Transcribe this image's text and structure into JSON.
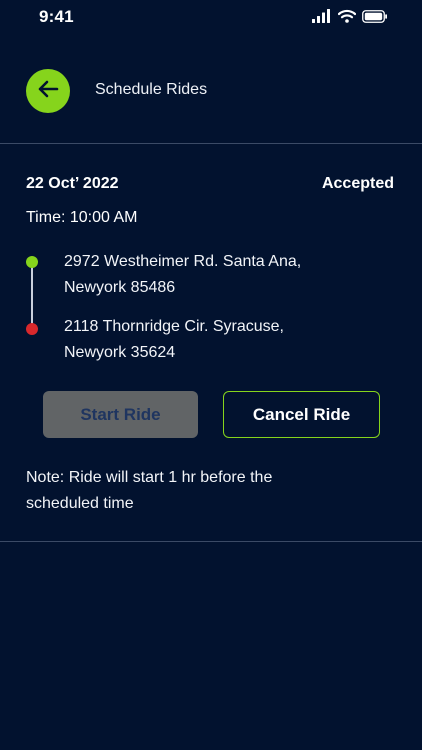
{
  "status_bar": {
    "time": "9:41",
    "icons": [
      "cellular-signal-icon",
      "wifi-icon",
      "battery-icon"
    ]
  },
  "header": {
    "back_icon": "arrow-left-icon",
    "title": "Schedule Rides"
  },
  "ride": {
    "date": "22 Oct’ 2022",
    "status": "Accepted",
    "time": "Time: 10:00 AM",
    "pickup": {
      "line1": "2972 Westheimer Rd. Santa Ana,",
      "line2": "Newyork 85486"
    },
    "drop": {
      "line1": "2118 Thornridge Cir. Syracuse,",
      "line2": "Newyork 35624"
    },
    "start_label": "Start Ride",
    "cancel_label": "Cancel Ride",
    "note_line1": "Note: Ride will start 1 hr before the",
    "note_line2": "scheduled time"
  },
  "colors": {
    "background": "#02122f",
    "accent": "#86d41c",
    "drop_marker": "#d8282c",
    "disabled_button": "#616466"
  }
}
